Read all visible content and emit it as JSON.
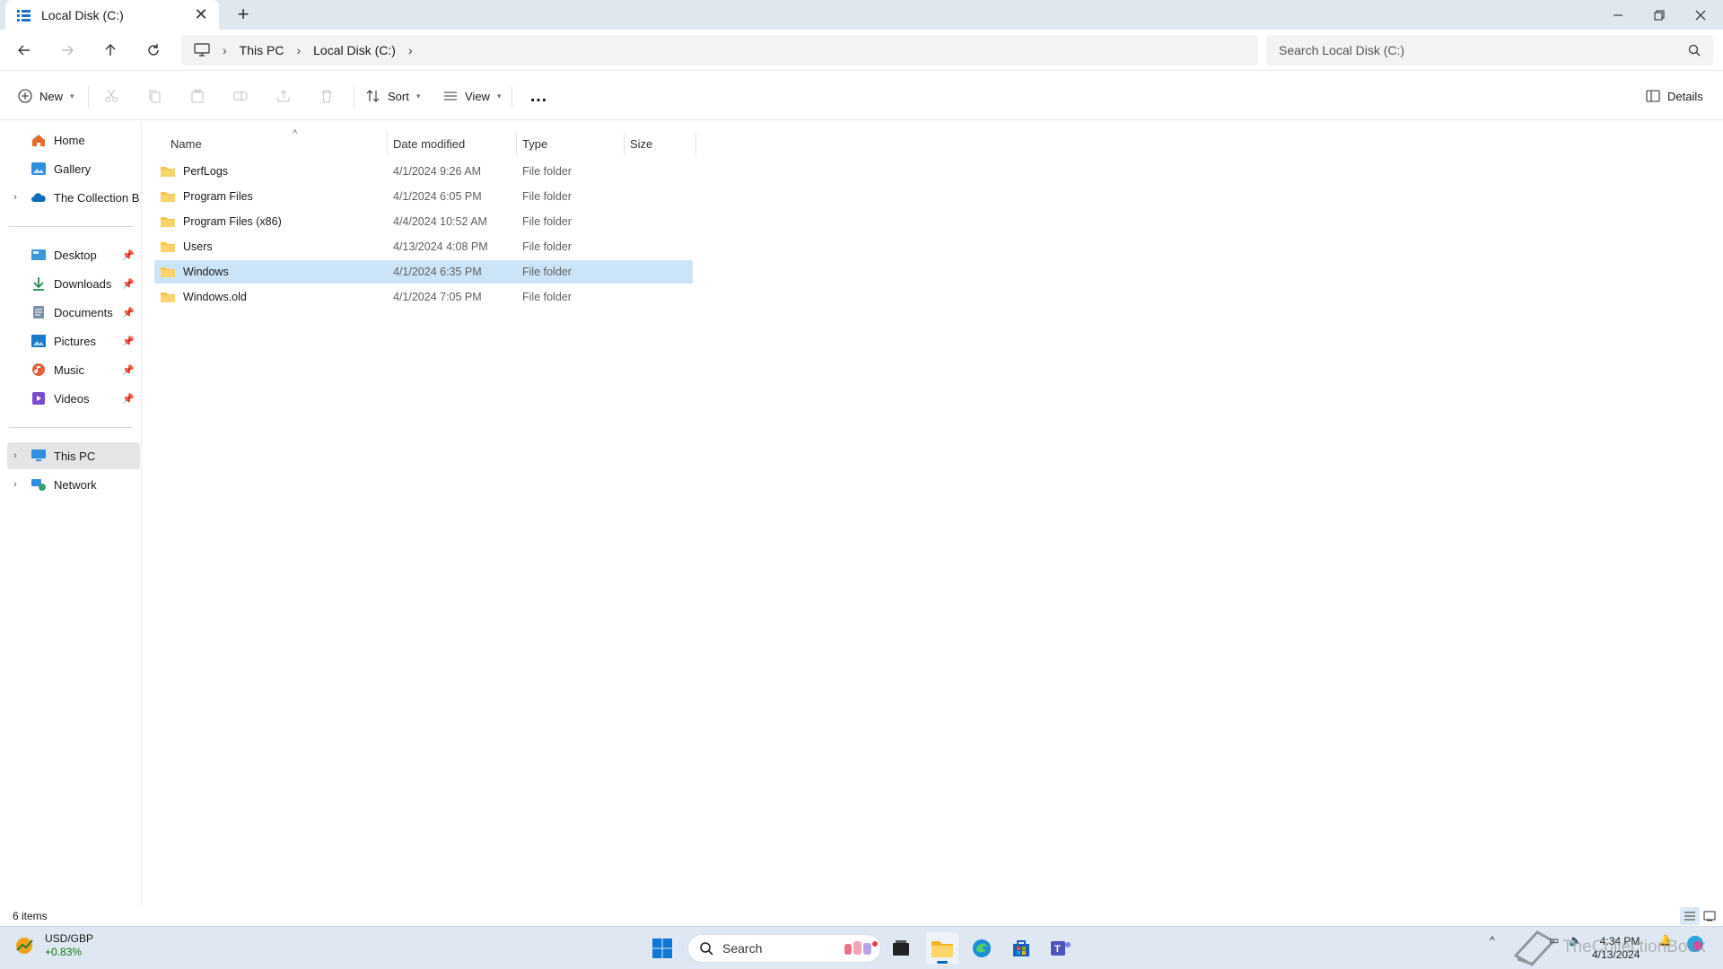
{
  "window": {
    "tab_title": "Local Disk (C:)",
    "new_tab": "+"
  },
  "address": {
    "crumbs": [
      "This PC",
      "Local Disk (C:)"
    ],
    "search_placeholder": "Search Local Disk (C:)"
  },
  "command_bar": {
    "new_label": "New",
    "sort_label": "Sort",
    "view_label": "View",
    "more_label": "…",
    "details_label": "Details"
  },
  "sidebar": {
    "top_items": [
      {
        "label": "Home",
        "icon": "home-icon"
      },
      {
        "label": "Gallery",
        "icon": "gallery-icon"
      },
      {
        "label": "The Collection Boo",
        "icon": "onedrive-icon"
      }
    ],
    "pinned_items": [
      {
        "label": "Desktop",
        "icon": "desktop-icon"
      },
      {
        "label": "Downloads",
        "icon": "downloads-icon"
      },
      {
        "label": "Documents",
        "icon": "documents-icon"
      },
      {
        "label": "Pictures",
        "icon": "pictures-icon"
      },
      {
        "label": "Music",
        "icon": "music-icon"
      },
      {
        "label": "Videos",
        "icon": "videos-icon"
      }
    ],
    "drives": [
      {
        "label": "This PC",
        "icon": "this-pc-icon",
        "selected": true
      },
      {
        "label": "Network",
        "icon": "network-icon"
      }
    ]
  },
  "file_list": {
    "columns": [
      "Name",
      "Date modified",
      "Type",
      "Size"
    ],
    "rows": [
      {
        "name": "PerfLogs",
        "date": "4/1/2024 9:26 AM",
        "type": "File folder",
        "size": ""
      },
      {
        "name": "Program Files",
        "date": "4/1/2024 6:05 PM",
        "type": "File folder",
        "size": ""
      },
      {
        "name": "Program Files (x86)",
        "date": "4/4/2024 10:52 AM",
        "type": "File folder",
        "size": ""
      },
      {
        "name": "Users",
        "date": "4/13/2024 4:08 PM",
        "type": "File folder",
        "size": ""
      },
      {
        "name": "Windows",
        "date": "4/1/2024 6:35 PM",
        "type": "File folder",
        "size": "",
        "selected": true
      },
      {
        "name": "Windows.old",
        "date": "4/1/2024 7:05 PM",
        "type": "File folder",
        "size": ""
      }
    ]
  },
  "status": {
    "item_count": "6 items"
  },
  "taskbar": {
    "widget_title": "USD/GBP",
    "widget_change": "+0.83%",
    "search_label": "Search",
    "time": "4:34 PM",
    "date": "4/13/2024",
    "watermark": "TheCollectionBook"
  },
  "colors": {
    "accent": "#0067c0",
    "selection": "#cce4f7",
    "folder": "#f8c544"
  }
}
